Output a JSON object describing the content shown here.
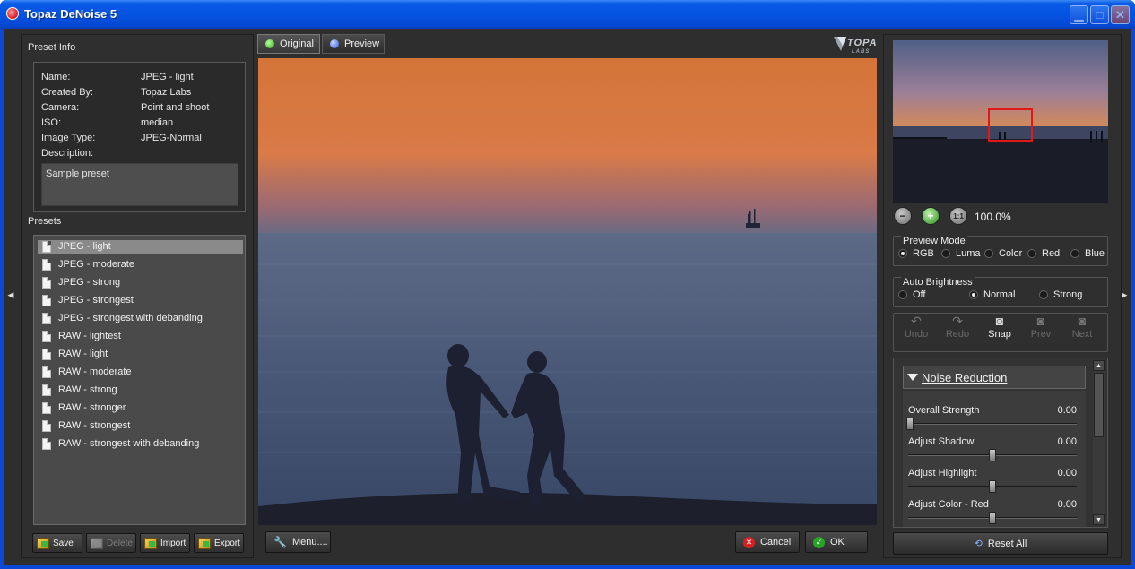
{
  "window": {
    "title": "Topaz DeNoise 5",
    "controls": {
      "minimize": "▁",
      "maximize": "□",
      "close": "✕"
    }
  },
  "left": {
    "preset_info_title": "Preset Info",
    "info": [
      {
        "label": "Name:",
        "value": "JPEG - light"
      },
      {
        "label": "Created By:",
        "value": "Topaz Labs"
      },
      {
        "label": "Camera:",
        "value": "Point and shoot"
      },
      {
        "label": "ISO:",
        "value": "median"
      },
      {
        "label": "Image Type:",
        "value": "JPEG-Normal"
      },
      {
        "label": "Description:",
        "value": ""
      }
    ],
    "description": "Sample preset",
    "presets_title": "Presets",
    "presets": [
      "JPEG - light",
      "JPEG - moderate",
      "JPEG - strong",
      "JPEG - strongest",
      "JPEG - strongest with debanding",
      "RAW - lightest",
      "RAW - light",
      "RAW - moderate",
      "RAW - strong",
      "RAW - stronger",
      "RAW - strongest",
      "RAW - strongest with debanding"
    ],
    "selected_preset": "JPEG - light",
    "buttons": {
      "save": "Save",
      "delete": "Delete",
      "import": "Import",
      "export": "Export"
    }
  },
  "center": {
    "tabs": {
      "original": "Original",
      "preview": "Preview"
    },
    "logo_text": "TOPAZ",
    "menu_label": "Menu....",
    "cancel_label": "Cancel",
    "ok_label": "OK"
  },
  "right": {
    "zoom_level": "100.0%",
    "zoom_icons": [
      "zoom-out-icon",
      "zoom-in-icon",
      "zoom-actual-size-icon"
    ],
    "preview_mode": {
      "title": "Preview Mode",
      "options": [
        "RGB",
        "Luma",
        "Color",
        "Red",
        "Blue"
      ],
      "selected": "RGB"
    },
    "auto_brightness": {
      "title": "Auto Brightness",
      "options": [
        "Off",
        "Normal",
        "Strong"
      ],
      "selected": "Normal"
    },
    "history": {
      "undo": "Undo",
      "redo": "Redo",
      "snap": "Snap",
      "prev": "Prev",
      "next": "Next"
    },
    "noise_reduction": {
      "title": "Noise Reduction",
      "sliders": [
        {
          "label": "Overall Strength",
          "value": "0.00",
          "fraction": 0.0
        },
        {
          "label": "Adjust Shadow",
          "value": "0.00",
          "fraction": 0.5
        },
        {
          "label": "Adjust Highlight",
          "value": "0.00",
          "fraction": 0.5
        },
        {
          "label": "Adjust Color - Red",
          "value": "0.00",
          "fraction": 0.5
        }
      ]
    },
    "reset_all": "Reset All"
  },
  "colors": {
    "titlebar": "#0553e1",
    "panel_bg": "#2f2f2f",
    "selection": "#8a8a8a",
    "nav_rect": "#e01818"
  }
}
